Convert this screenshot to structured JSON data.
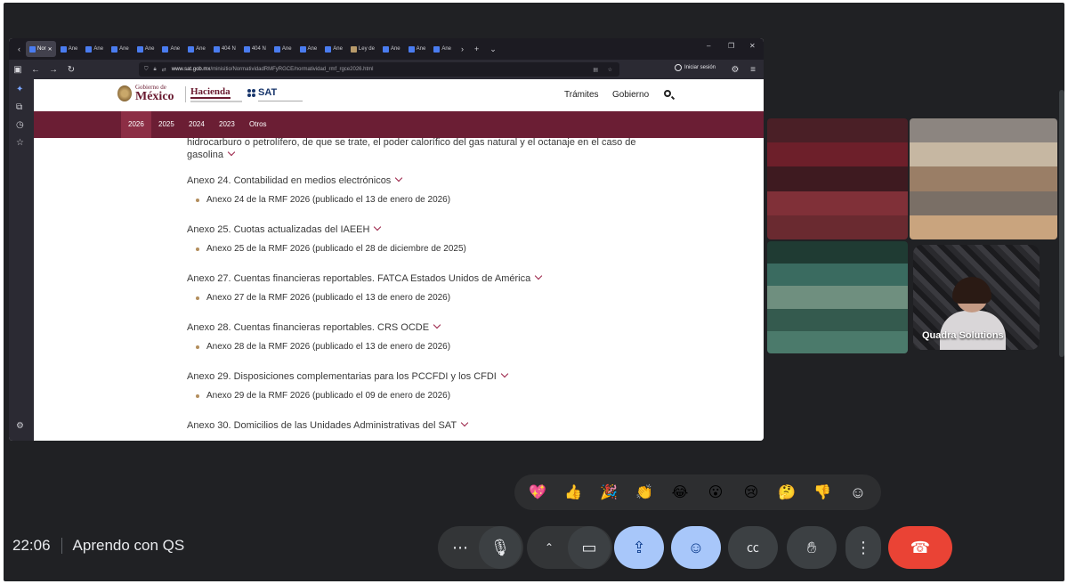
{
  "browser": {
    "tabs": [
      {
        "label": "Nor",
        "active": true,
        "icon": "grid-favicon"
      },
      {
        "label": "Ane",
        "icon": "grid-favicon"
      },
      {
        "label": "Ane",
        "icon": "grid-favicon"
      },
      {
        "label": "Ane",
        "icon": "grid-favicon"
      },
      {
        "label": "Ane",
        "icon": "grid-favicon"
      },
      {
        "label": "Ane",
        "icon": "grid-favicon"
      },
      {
        "label": "Ane",
        "icon": "grid-favicon"
      },
      {
        "label": "404 N",
        "icon": "grid-favicon"
      },
      {
        "label": "404 N",
        "icon": "grid-favicon"
      },
      {
        "label": "Ane",
        "icon": "grid-favicon"
      },
      {
        "label": "Ane",
        "icon": "grid-favicon"
      },
      {
        "label": "Ane",
        "icon": "grid-favicon"
      },
      {
        "label": "Ley de",
        "icon": "document-favicon"
      },
      {
        "label": "Ane",
        "icon": "grid-favicon"
      },
      {
        "label": "Ane",
        "icon": "grid-favicon"
      },
      {
        "label": "Ane",
        "icon": "grid-favicon"
      }
    ],
    "url_host": "www.sat.gob.mx",
    "url_path": "/minisitio/NormatividadRMFyRGCE/normatividad_rmf_rgce2026.html",
    "signin_label": "Iniciar sesión"
  },
  "site": {
    "gob_small": "Gobierno de",
    "gob_big": "México",
    "hacienda": "Hacienda",
    "sat": "SAT",
    "nav": [
      "Trámites",
      "Gobierno"
    ],
    "years": [
      "2026",
      "2025",
      "2024",
      "2023",
      "Otros"
    ],
    "selected_year": "2026"
  },
  "doc": {
    "intro": "hidrocarburo o petrolífero, de que se trate, el poder calorífico del gas natural y el octanaje en el caso de gasolina",
    "annexes": [
      {
        "title": "Anexo 24. Contabilidad en medios electrónicos",
        "item": "Anexo 24 de la RMF 2026 (publicado el 13 de enero de 2026)"
      },
      {
        "title": "Anexo 25. Cuotas actualizadas del IAEEH",
        "item": "Anexo 25 de la RMF 2026 (publicado el 28 de diciembre de 2025)"
      },
      {
        "title": "Anexo 27. Cuentas financieras reportables. FATCA Estados Unidos de América",
        "item": "Anexo 27 de la RMF 2026 (publicado el 13 de enero de 2026)"
      },
      {
        "title": "Anexo 28. Cuentas financieras reportables. CRS OCDE",
        "item": "Anexo 28 de la RMF 2026 (publicado el 13 de enero de 2026)"
      },
      {
        "title": "Anexo 29. Disposiciones complementarias para los PCCFDI y los CFDI",
        "item": "Anexo 29 de la RMF 2026 (publicado el 09 de enero de 2026)"
      },
      {
        "title": "Anexo 30. Domicilios de las Unidades Administrativas del SAT",
        "item": ""
      }
    ]
  },
  "participants": {
    "self_name": "Quadra Solutions"
  },
  "reactions": [
    "💖",
    "👍",
    "🎉",
    "👏",
    "😂",
    "😮",
    "😢",
    "🤔",
    "👎",
    "smile-plus-icon"
  ],
  "meeting": {
    "time": "22:06",
    "name": "Aprendo con QS"
  },
  "colors": {
    "gob_maroon": "#6b1e34",
    "meet_bg": "#202124",
    "accent_blue": "#a8c7fa",
    "end_red": "#ea4335"
  }
}
